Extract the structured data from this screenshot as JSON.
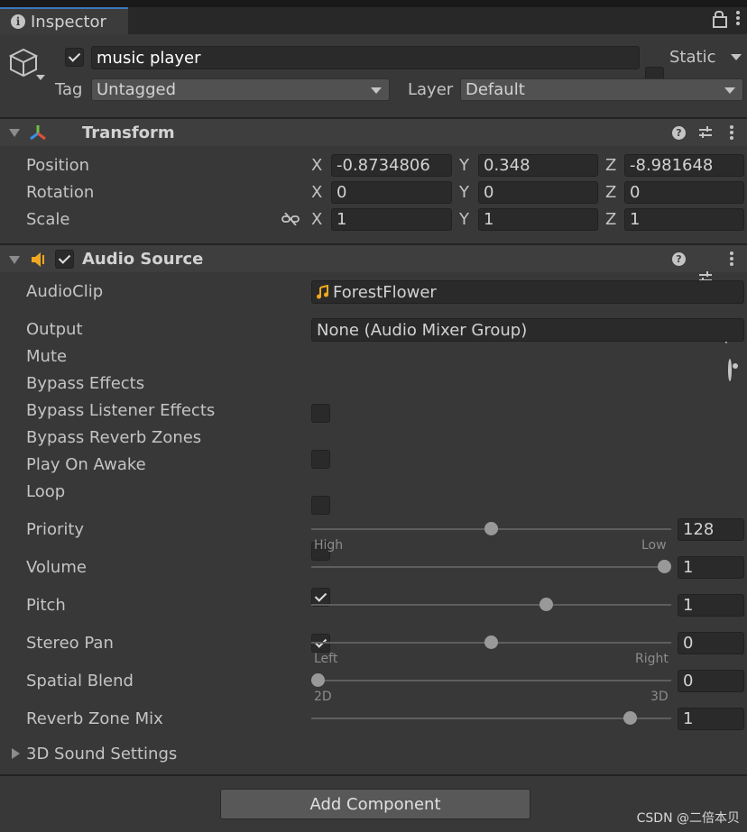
{
  "tab": {
    "title": "Inspector"
  },
  "object": {
    "name": "music player",
    "active": true,
    "static_label": "Static",
    "static": false,
    "tag_label": "Tag",
    "tag": "Untagged",
    "layer_label": "Layer",
    "layer": "Default"
  },
  "transform": {
    "title": "Transform",
    "position": {
      "label": "Position",
      "x": "-0.8734806",
      "y": "0.348",
      "z": "-8.981648"
    },
    "rotation": {
      "label": "Rotation",
      "x": "0",
      "y": "0",
      "z": "0"
    },
    "scale": {
      "label": "Scale",
      "x": "1",
      "y": "1",
      "z": "1"
    },
    "axes": {
      "x": "X",
      "y": "Y",
      "z": "Z"
    }
  },
  "audio": {
    "title": "Audio Source",
    "enabled": true,
    "clip": {
      "label": "AudioClip",
      "value": "ForestFlower"
    },
    "output": {
      "label": "Output",
      "value": "None (Audio Mixer Group)"
    },
    "toggles": [
      {
        "label": "Mute",
        "checked": false
      },
      {
        "label": "Bypass Effects",
        "checked": false
      },
      {
        "label": "Bypass Listener Effects",
        "checked": false
      },
      {
        "label": "Bypass Reverb Zones",
        "checked": false
      },
      {
        "label": "Play On Awake",
        "checked": true
      },
      {
        "label": "Loop",
        "checked": true
      }
    ],
    "priority": {
      "label": "Priority",
      "value": "128",
      "min_label": "High",
      "max_label": "Low",
      "fraction": 0.5
    },
    "volume": {
      "label": "Volume",
      "value": "1",
      "fraction": 1.0
    },
    "pitch": {
      "label": "Pitch",
      "value": "1",
      "fraction": 0.66
    },
    "stereo_pan": {
      "label": "Stereo Pan",
      "value": "0",
      "min_label": "Left",
      "max_label": "Right",
      "fraction": 0.5
    },
    "spatial_blend": {
      "label": "Spatial Blend",
      "value": "0",
      "min_label": "2D",
      "max_label": "3D",
      "fraction": 0.0
    },
    "reverb_zone_mix": {
      "label": "Reverb Zone Mix",
      "value": "1",
      "fraction": 0.9
    },
    "sound_settings": {
      "label": "3D Sound Settings"
    }
  },
  "add_component": {
    "label": "Add Component"
  },
  "watermark": "CSDN @二倍本贝",
  "colors": {
    "accent": "#3a79bb",
    "audio_icon": "#f0a81e"
  }
}
